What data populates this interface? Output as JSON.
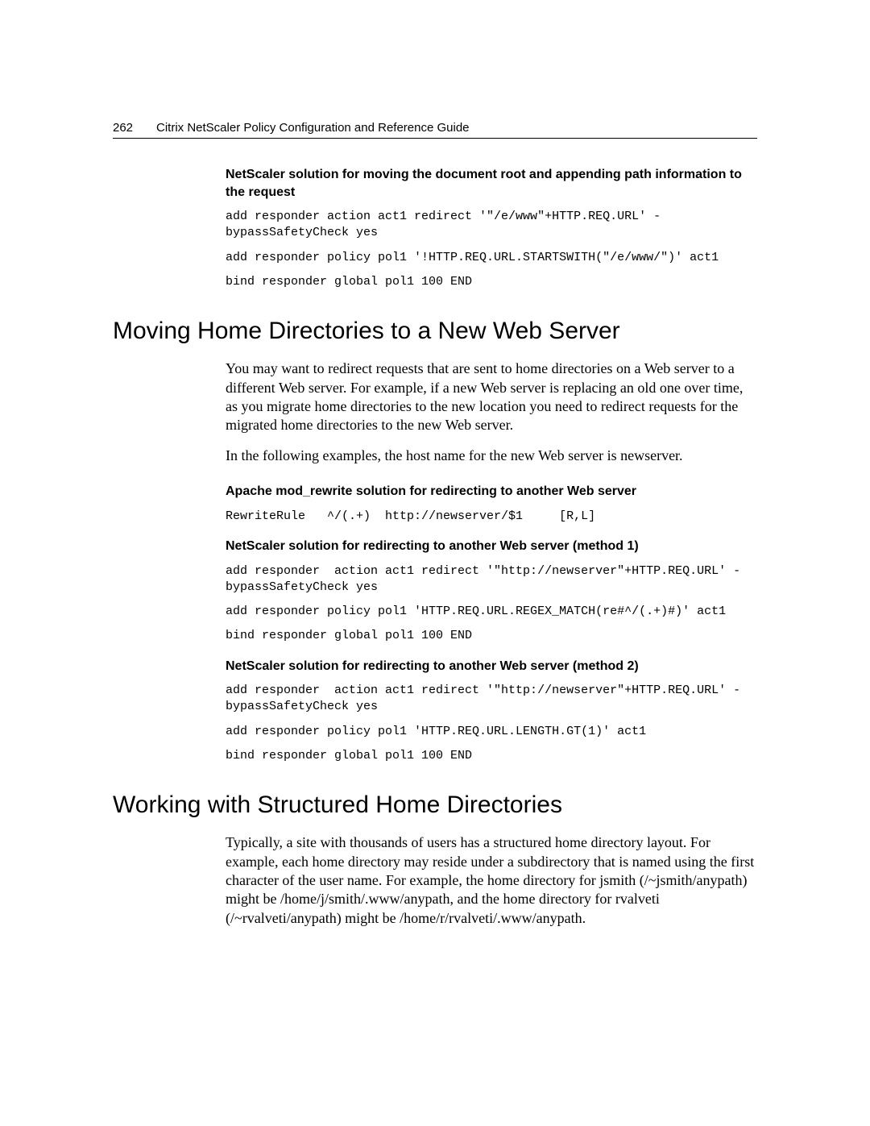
{
  "header": {
    "page_number": "262",
    "title": "Citrix NetScaler Policy Configuration and Reference Guide"
  },
  "block1": {
    "subheading": "NetScaler solution for moving the document root and appending path information to the request",
    "code1": "add responder action act1 redirect '\"/e/www\"+HTTP.REQ.URL' -bypassSafetyCheck yes",
    "code2": "add responder policy pol1 '!HTTP.REQ.URL.STARTSWITH(\"/e/www/\")' act1",
    "code3": "bind responder global pol1 100 END"
  },
  "section1": {
    "heading": "Moving Home Directories to a New Web Server",
    "para1": "You may want to redirect requests that are sent to home directories on a Web server to a different Web server. For example, if a new Web server is replacing an old one over time, as you migrate home directories to the new location you need to redirect requests for the migrated home directories to the new Web server.",
    "para2": "In the following examples, the host name for the new Web server is newserver.",
    "sub1": "Apache mod_rewrite solution for redirecting to another Web server",
    "code1": "RewriteRule   ^/(.+)  http://newserver/$1     [R,L]",
    "sub2": "NetScaler solution for redirecting to another Web server (method 1)",
    "code2a": "add responder  action act1 redirect '\"http://newserver\"+HTTP.REQ.URL' -bypassSafetyCheck yes",
    "code2b": "add responder policy pol1 'HTTP.REQ.URL.REGEX_MATCH(re#^/(.+)#)' act1",
    "code2c": "bind responder global pol1 100 END",
    "sub3": "NetScaler solution for redirecting to another Web server (method 2)",
    "code3a": "add responder  action act1 redirect '\"http://newserver\"+HTTP.REQ.URL' -bypassSafetyCheck yes",
    "code3b": "add responder policy pol1 'HTTP.REQ.URL.LENGTH.GT(1)' act1",
    "code3c": "bind responder global pol1 100 END"
  },
  "section2": {
    "heading": "Working with Structured Home Directories",
    "para1": "Typically, a site with thousands of users has a structured home directory layout. For example, each home directory may reside under a subdirectory that is named using the first character of the user name. For example, the home directory for jsmith (/~jsmith/anypath) might be /home/j/smith/.www/anypath, and the home directory for rvalveti (/~rvalveti/anypath) might be /home/r/rvalveti/.www/anypath."
  }
}
